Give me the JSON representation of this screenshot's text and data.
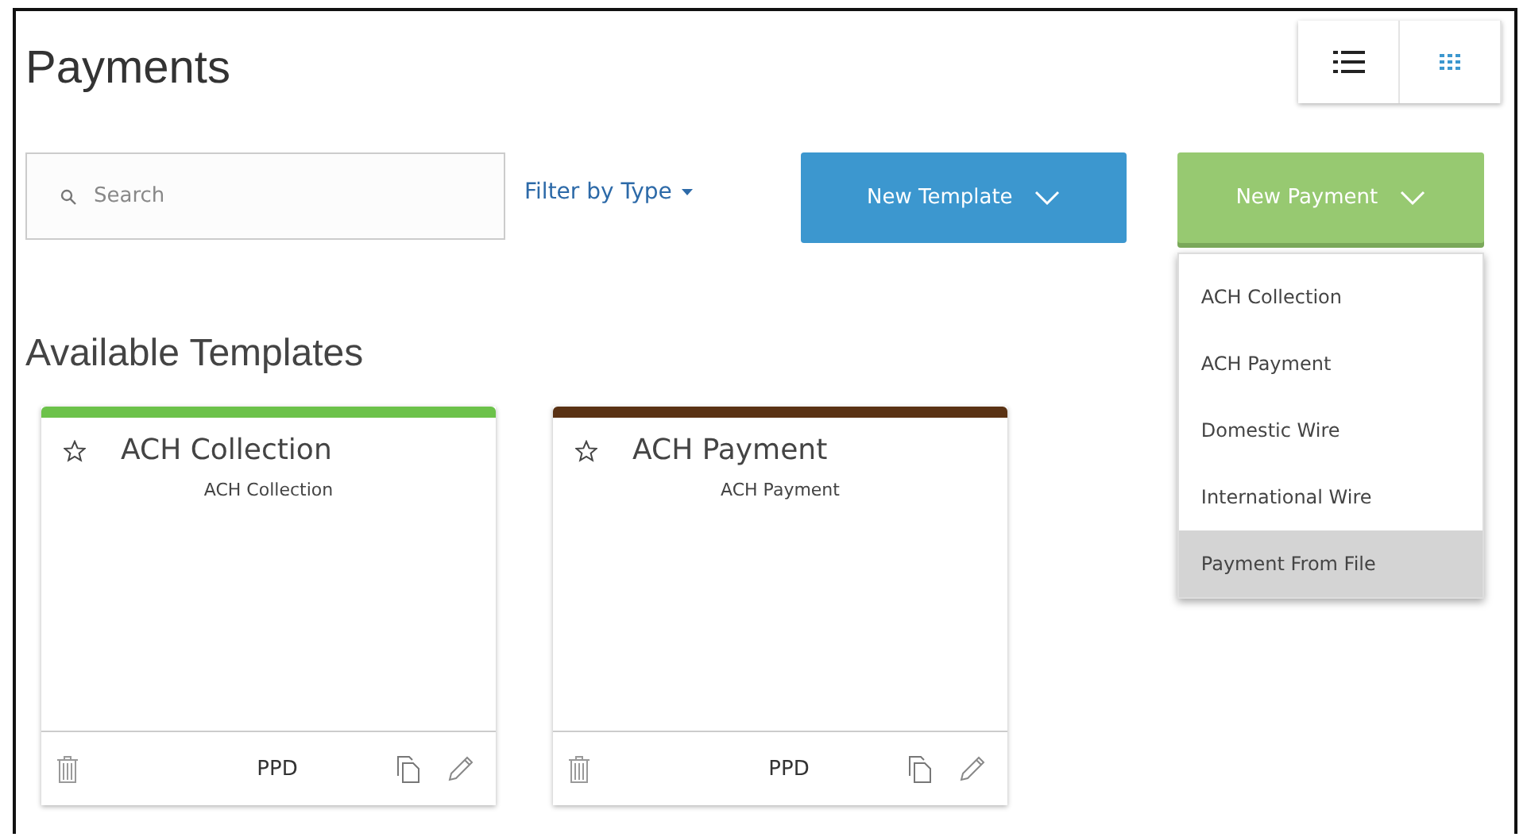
{
  "page": {
    "title": "Payments"
  },
  "view_toggle": [
    {
      "kind": "list",
      "selected": false
    },
    {
      "kind": "grid",
      "selected": true
    }
  ],
  "search": {
    "placeholder": "Search"
  },
  "filter": {
    "label": "Filter by Type"
  },
  "new_template": {
    "label": "New Template"
  },
  "new_payment": {
    "label": "New Payment",
    "expanded": true,
    "menu": [
      {
        "label": "ACH Collection",
        "highlighted": false
      },
      {
        "label": "ACH Payment",
        "highlighted": false
      },
      {
        "label": "Domestic Wire",
        "highlighted": false
      },
      {
        "label": "International Wire",
        "highlighted": false
      },
      {
        "label": "Payment From File",
        "highlighted": true
      }
    ]
  },
  "section_title": "Available Templates",
  "templates": [
    {
      "title": "ACH Collection",
      "subtitle": "ACH Collection",
      "code": "PPD",
      "color": "#6cc24a",
      "starred": false
    },
    {
      "title": "ACH Payment",
      "subtitle": "ACH Payment",
      "code": "PPD",
      "color": "#5a3214",
      "starred": false
    }
  ]
}
